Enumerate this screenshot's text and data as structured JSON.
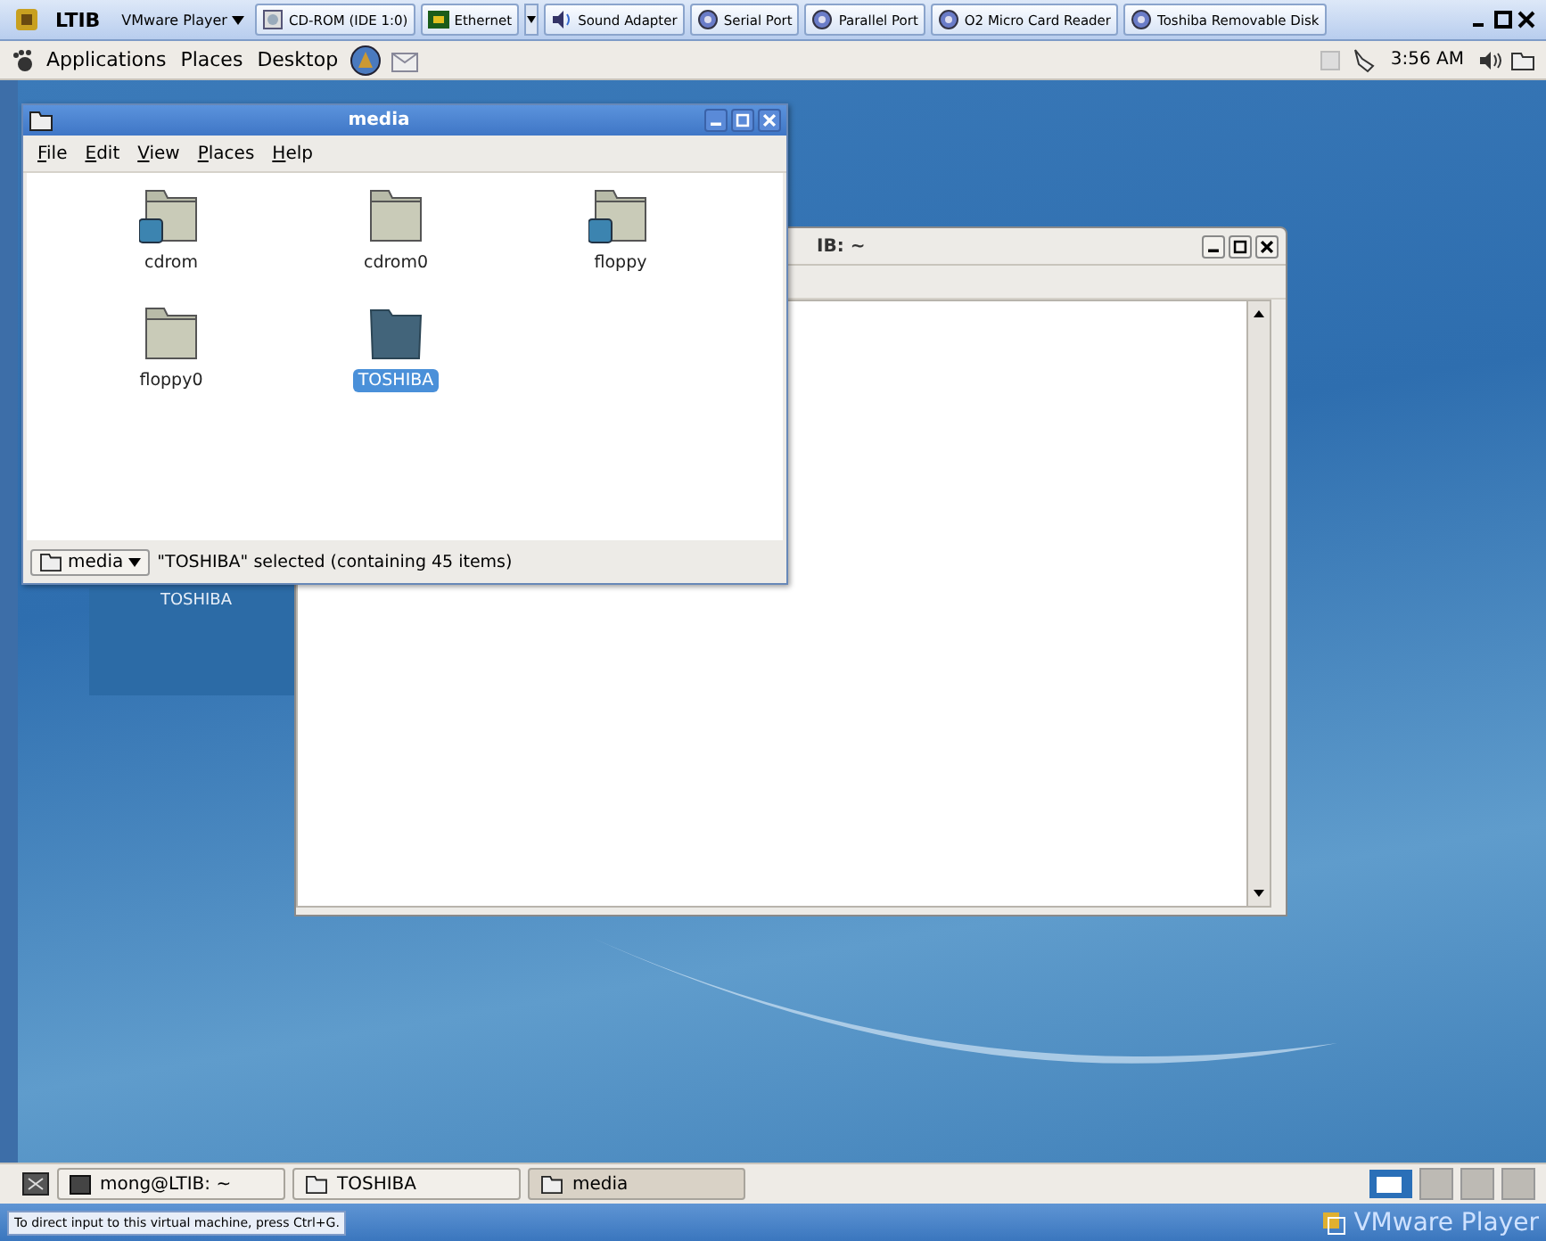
{
  "vm_toolbar": {
    "title": "LTIB",
    "menu": "VMware Player",
    "devices": [
      {
        "label": "CD-ROM (IDE 1:0)",
        "kind": "cd"
      },
      {
        "label": "Ethernet",
        "kind": "network"
      },
      {
        "label": "Sound Adapter",
        "kind": "sound"
      },
      {
        "label": "Serial Port",
        "kind": "port"
      },
      {
        "label": "Parallel Port",
        "kind": "port"
      },
      {
        "label": "O2 Micro Card Reader",
        "kind": "port"
      },
      {
        "label": "Toshiba Removable Disk",
        "kind": "port"
      }
    ]
  },
  "top_panel": {
    "menus": [
      "Applications",
      "Places",
      "Desktop"
    ],
    "clock": "3:56 AM"
  },
  "desktop_icons": [
    {
      "label": "TOSHIBA"
    }
  ],
  "terminal_window": {
    "title": "IB: ~"
  },
  "file_window": {
    "title": "media",
    "menu": [
      "File",
      "Edit",
      "View",
      "Places",
      "Help"
    ],
    "items": [
      {
        "label": "cdrom",
        "kind": "drive",
        "selected": false
      },
      {
        "label": "cdrom0",
        "kind": "folder",
        "selected": false
      },
      {
        "label": "floppy",
        "kind": "drive",
        "selected": false
      },
      {
        "label": "floppy0",
        "kind": "folder",
        "selected": false
      },
      {
        "label": "TOSHIBA",
        "kind": "mounted",
        "selected": true
      }
    ],
    "location": "media",
    "status": "\"TOSHIBA\" selected (containing 45 items)"
  },
  "taskbar": {
    "tasks": [
      {
        "label": "mong@LTIB: ~",
        "kind": "terminal",
        "selected": false
      },
      {
        "label": "TOSHIBA",
        "kind": "folder",
        "selected": false
      },
      {
        "label": "media",
        "kind": "folder",
        "selected": true
      }
    ]
  },
  "vm_status": {
    "hint": "To direct input to this virtual machine, press Ctrl+G.",
    "brand": "VMware Player"
  }
}
